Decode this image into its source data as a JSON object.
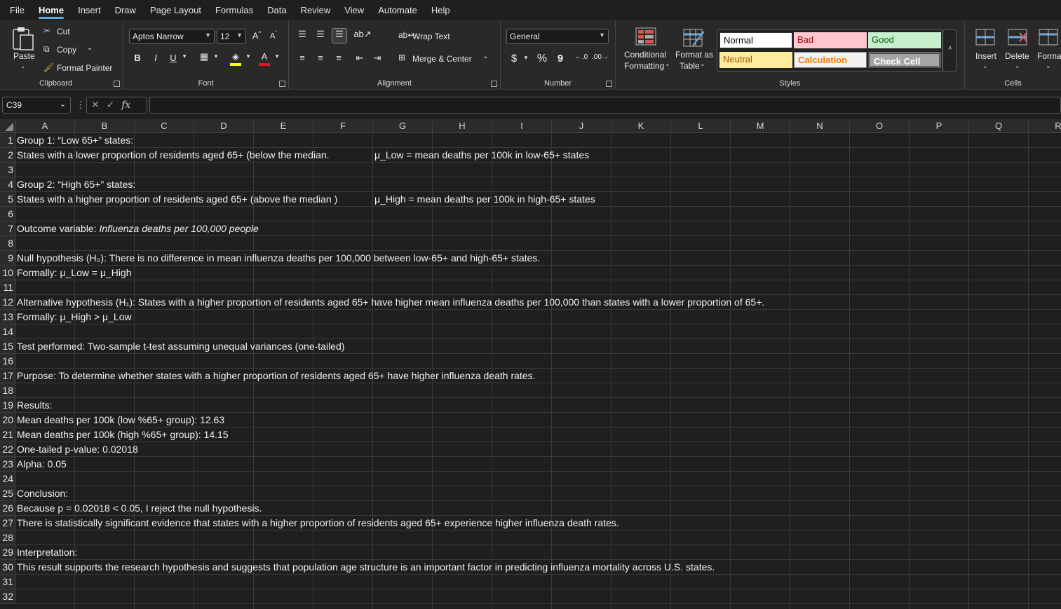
{
  "menu": [
    "File",
    "Home",
    "Insert",
    "Draw",
    "Page Layout",
    "Formulas",
    "Data",
    "Review",
    "View",
    "Automate",
    "Help"
  ],
  "ribbon": {
    "clipboard": {
      "paste": "Paste",
      "cut": "Cut",
      "copy": "Copy",
      "format_painter": "Format Painter",
      "label": "Clipboard"
    },
    "font": {
      "family": "Aptos Narrow",
      "size": "12",
      "bold": "B",
      "italic": "I",
      "underline": "U",
      "label": "Font",
      "grow": "A^",
      "shrink": "Aˇ"
    },
    "alignment": {
      "wrap_text": "Wrap Text",
      "merge_center": "Merge & Center",
      "label": "Alignment"
    },
    "number": {
      "format": "General",
      "currency": "$",
      "percent": "%",
      "comma": "9",
      "label": "Number"
    },
    "styles": {
      "conditional_formatting": [
        "Conditional",
        "Formatting"
      ],
      "format_as_table": [
        "Format as",
        "Table"
      ],
      "normal": "Normal",
      "bad": "Bad",
      "good": "Good",
      "neutral": "Neutral",
      "calculation": "Calculation",
      "check_cell": "Check Cell",
      "label": "Styles"
    },
    "cells": {
      "insert": "Insert",
      "delete": "Delete",
      "format": "Format",
      "label": "Cells"
    }
  },
  "formula_bar": {
    "name_box": "C39",
    "fx": "fx",
    "value": ""
  },
  "columns": [
    "A",
    "B",
    "C",
    "D",
    "E",
    "F",
    "G",
    "H",
    "I",
    "J",
    "K",
    "L",
    "M",
    "N",
    "O",
    "P",
    "Q",
    "R"
  ],
  "rows": [
    "1",
    "2",
    "3",
    "4",
    "5",
    "6",
    "7",
    "8",
    "9",
    "10",
    "11",
    "12",
    "13",
    "14",
    "15",
    "16",
    "17",
    "18",
    "19",
    "20",
    "21",
    "22",
    "23",
    "24",
    "25",
    "26",
    "27",
    "28",
    "29",
    "30",
    "31",
    "32"
  ],
  "cells": {
    "A1": "Group 1: “Low 65+” states:",
    "A2": "States with a lower proportion of residents aged 65+ (below the median.",
    "G2": "μ_Low = mean deaths per 100k in low-65+ states",
    "A4": "Group 2: “High 65+” states:",
    "A5": "States with a higher proportion of residents aged 65+ (above the median )",
    "G5": "μ_High = mean deaths per 100k in high-65+ states",
    "A7_prefix": "Outcome variable: ",
    "A7_italic": "Influenza deaths per 100,000 people",
    "A9": "Null hypothesis (H₀): There is no difference in mean influenza deaths per 100,000 between low-65+ and high-65+ states.",
    "A10": "Formally: μ_Low = μ_High",
    "A12": "Alternative hypothesis (H₁): States with a higher proportion of residents aged 65+ have higher mean influenza deaths per 100,000 than states with a lower proportion of 65+.",
    "A13": "Formally: μ_High > μ_Low",
    "A15": "Test performed: Two-sample t-test assuming unequal variances (one-tailed)",
    "A17": "Purpose: To determine whether states with a higher proportion of residents aged 65+ have higher influenza death rates.",
    "A19": "Results:",
    "A20": "Mean deaths per 100k (low %65+ group): 12.63",
    "A21": "Mean deaths per 100k (high %65+ group): 14.15",
    "A22": "One-tailed p-value: 0.02018",
    "A23": "Alpha: 0.05",
    "A25": "Conclusion:",
    "A26": "Because p = 0.02018 < 0.05, I reject the null hypothesis.",
    "A27": "There is statistically significant evidence that states with a higher proportion of residents aged 65+ experience higher influenza death rates.",
    "A29": "Interpretation:",
    "A30": "This result supports the research hypothesis and suggests that population age structure is an important factor in predicting influenza mortality across U.S. states."
  }
}
